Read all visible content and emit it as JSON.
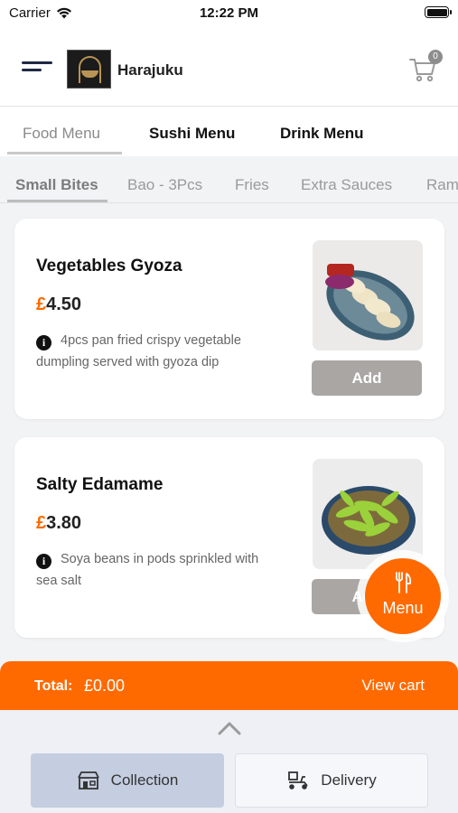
{
  "status_bar": {
    "carrier": "Carrier",
    "time": "12:22 PM"
  },
  "header": {
    "brand": "Harajuku",
    "cart_count": "0"
  },
  "main_tabs": [
    {
      "label": "Food Menu",
      "active": true
    },
    {
      "label": "Sushi Menu",
      "active": false
    },
    {
      "label": "Drink Menu",
      "active": false
    }
  ],
  "category_tabs": [
    {
      "label": "Small Bites",
      "active": true
    },
    {
      "label": "Bao - 3Pcs",
      "active": false
    },
    {
      "label": "Fries",
      "active": false
    },
    {
      "label": "Extra Sauces",
      "active": false
    },
    {
      "label": "Ram",
      "active": false
    }
  ],
  "items": [
    {
      "name": "Vegetables Gyoza",
      "currency": "£",
      "price": "4.50",
      "description": "4pcs pan fried crispy vegetable dumpling served with gyoza dip",
      "add_label": "Add"
    },
    {
      "name": "Salty Edamame",
      "currency": "£",
      "price": "3.80",
      "description": "Soya beans in pods sprinkled with sea salt",
      "add_label": "Add"
    }
  ],
  "fab": {
    "label": "Menu",
    "icon": "fork-knife-icon"
  },
  "total_bar": {
    "label": "Total:",
    "amount": "£0.00",
    "view_cart": "View cart"
  },
  "order_modes": [
    {
      "label": "Collection",
      "icon": "shop-icon",
      "selected": true
    },
    {
      "label": "Delivery",
      "icon": "delivery-scooter-icon",
      "selected": false
    }
  ],
  "colors": {
    "accent": "#ff6a00",
    "navy": "#1f2a44",
    "add_button": "#a9a6a4",
    "selected_mode": "#c5cde0"
  }
}
